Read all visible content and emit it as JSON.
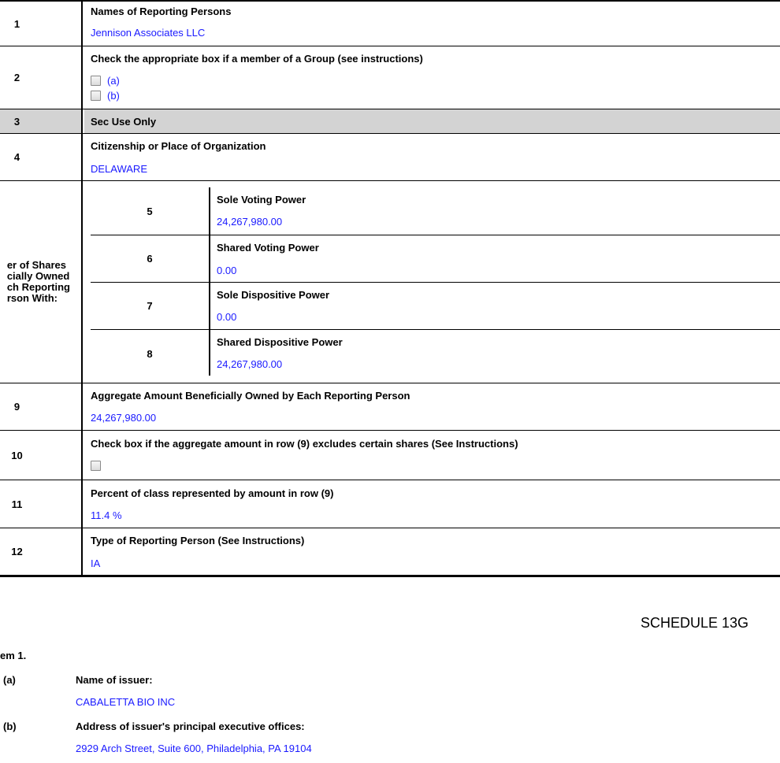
{
  "rows": {
    "r1": {
      "num": "1",
      "label": "Names of Reporting Persons",
      "value": "Jennison Associates LLC"
    },
    "r2": {
      "num": "2",
      "label": "Check the appropriate box if a member of a Group (see instructions)",
      "opt_a": "(a)",
      "opt_b": "(b)"
    },
    "r3": {
      "num": "3",
      "label": "Sec Use Only"
    },
    "r4": {
      "num": "4",
      "label": "Citizenship or Place of Organization",
      "value": "DELAWARE"
    },
    "shares_label": [
      "er of Shares",
      "cially Owned",
      "ch Reporting",
      "rson With:"
    ],
    "r5": {
      "num": "5",
      "label": "Sole Voting Power",
      "value": "24,267,980.00"
    },
    "r6": {
      "num": "6",
      "label": "Shared Voting Power",
      "value": "0.00"
    },
    "r7": {
      "num": "7",
      "label": "Sole Dispositive Power",
      "value": "0.00"
    },
    "r8": {
      "num": "8",
      "label": "Shared Dispositive Power",
      "value": "24,267,980.00"
    },
    "r9": {
      "num": "9",
      "label": "Aggregate Amount Beneficially Owned by Each Reporting Person",
      "value": "24,267,980.00"
    },
    "r10": {
      "num": "10",
      "label": "Check box if the aggregate amount in row (9) excludes certain shares (See Instructions)"
    },
    "r11": {
      "num": "11",
      "label": "Percent of class represented by amount in row (9)",
      "value": "11.4 %"
    },
    "r12": {
      "num": "12",
      "label": "Type of Reporting Person (See Instructions)",
      "value": "IA"
    }
  },
  "schedule_title": "SCHEDULE 13G",
  "item1": {
    "heading": "em 1.",
    "a": {
      "marker": "(a)",
      "label": "Name of issuer:",
      "value": "CABALETTA BIO INC"
    },
    "b": {
      "marker": "(b)",
      "label": "Address of issuer's principal executive offices:",
      "value": "2929 Arch Street, Suite 600, Philadelphia, PA 19104"
    }
  },
  "colors": {
    "value_text": "#1a1aff",
    "shade": "#d3d3d3"
  }
}
